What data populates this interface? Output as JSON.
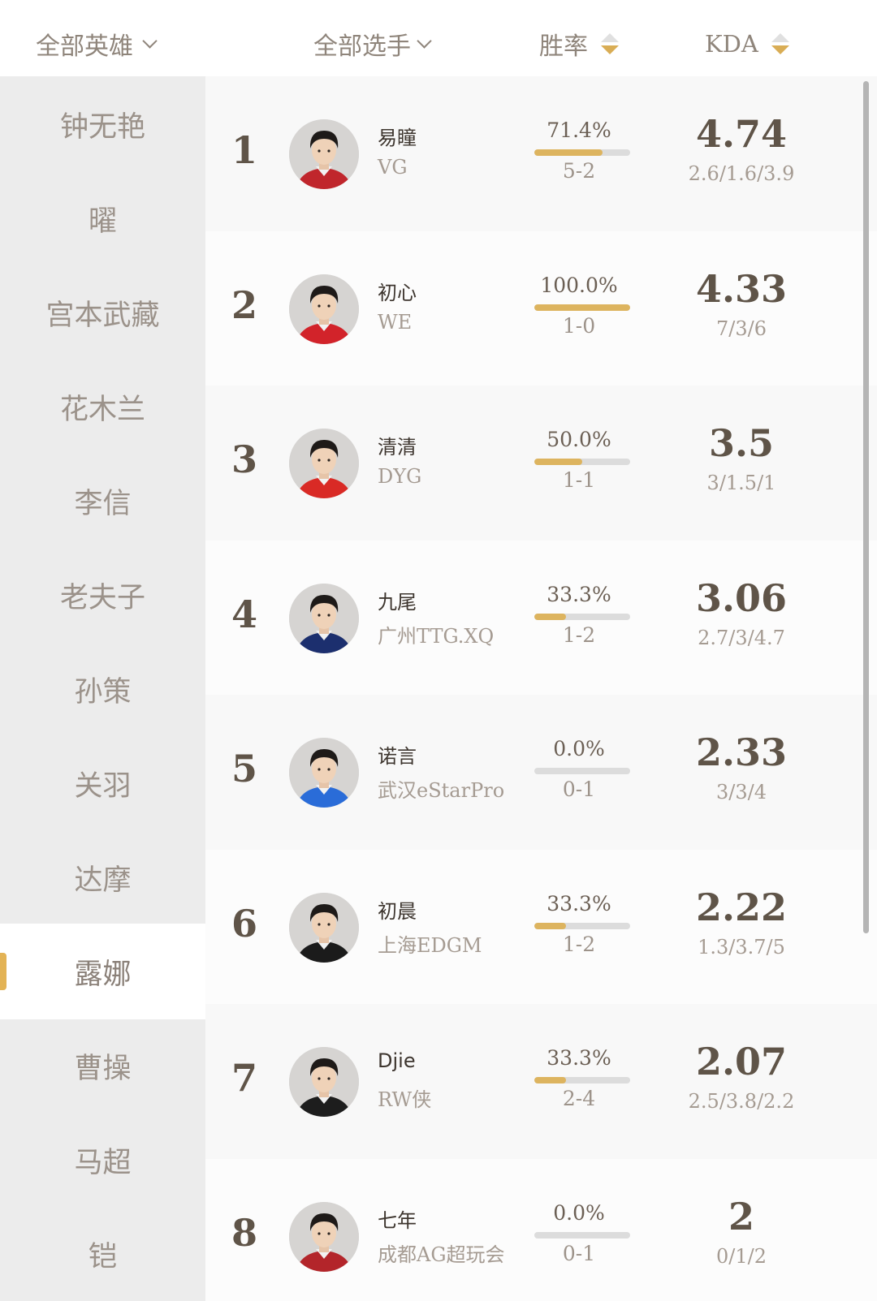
{
  "header": {
    "hero_filter": "全部英雄",
    "player_filter": "全部选手",
    "winrate_label": "胜率",
    "kda_label": "KDA"
  },
  "sidebar": {
    "items": [
      {
        "label": "钟无艳"
      },
      {
        "label": "曜"
      },
      {
        "label": "宫本武藏"
      },
      {
        "label": "花木兰"
      },
      {
        "label": "李信"
      },
      {
        "label": "老夫子"
      },
      {
        "label": "孙策"
      },
      {
        "label": "关羽"
      },
      {
        "label": "达摩"
      },
      {
        "label": "露娜",
        "active": true
      },
      {
        "label": "曹操"
      },
      {
        "label": "马超"
      },
      {
        "label": "铠"
      }
    ]
  },
  "players": [
    {
      "rank": "1",
      "name": "易瞳",
      "team": "VG",
      "winrate": "71.4%",
      "winrate_fraction": 0.714,
      "record": "5-2",
      "kda": "4.74",
      "kda_split": "2.6/1.6/3.9",
      "jersey": "#c0262c"
    },
    {
      "rank": "2",
      "name": "初心",
      "team": "WE",
      "winrate": "100.0%",
      "winrate_fraction": 1.0,
      "record": "1-0",
      "kda": "4.33",
      "kda_split": "7/3/6",
      "jersey": "#d2232a"
    },
    {
      "rank": "3",
      "name": "清清",
      "team": "DYG",
      "winrate": "50.0%",
      "winrate_fraction": 0.5,
      "record": "1-1",
      "kda": "3.5",
      "kda_split": "3/1.5/1",
      "jersey": "#d92a25"
    },
    {
      "rank": "4",
      "name": "九尾",
      "team": "广州TTG.XQ",
      "winrate": "33.3%",
      "winrate_fraction": 0.333,
      "record": "1-2",
      "kda": "3.06",
      "kda_split": "2.7/3/4.7",
      "jersey": "#1c2f6e"
    },
    {
      "rank": "5",
      "name": "诺言",
      "team": "武汉eStarPro",
      "winrate": "0.0%",
      "winrate_fraction": 0.0,
      "record": "0-1",
      "kda": "2.33",
      "kda_split": "3/3/4",
      "jersey": "#2a6cd8"
    },
    {
      "rank": "6",
      "name": "初晨",
      "team": "上海EDGM",
      "winrate": "33.3%",
      "winrate_fraction": 0.333,
      "record": "1-2",
      "kda": "2.22",
      "kda_split": "1.3/3.7/5",
      "jersey": "#1b1b1b"
    },
    {
      "rank": "7",
      "name": "Djie",
      "team": "RW侠",
      "winrate": "33.3%",
      "winrate_fraction": 0.333,
      "record": "2-4",
      "kda": "2.07",
      "kda_split": "2.5/3.8/2.2",
      "jersey": "#1d1d1d"
    },
    {
      "rank": "8",
      "name": "七年",
      "team": "成都AG超玩会",
      "winrate": "0.0%",
      "winrate_fraction": 0.0,
      "record": "0-1",
      "kda": "2",
      "kda_split": "0/1/2",
      "jersey": "#b3252a"
    }
  ],
  "colors": {
    "accent": "#ddb45f",
    "sidebar_bg": "#ececec",
    "bar_track": "#dcdcdc"
  }
}
